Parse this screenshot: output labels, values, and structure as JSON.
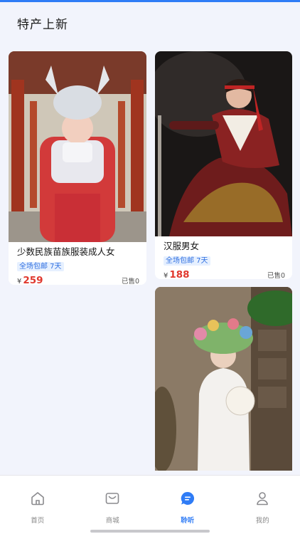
{
  "header": {
    "title": "特产上新"
  },
  "products": [
    {
      "name": "少数民族苗族服装成人女",
      "tag": "全场包邮 7天",
      "currency": "¥",
      "price": "259",
      "sold": "已售0"
    },
    {
      "name": "汉服男女",
      "tag": "全场包邮 7天",
      "currency": "¥",
      "price": "188",
      "sold": "已售0"
    }
  ],
  "tabbar": {
    "items": [
      {
        "label": "首页",
        "icon": "home-icon"
      },
      {
        "label": "商城",
        "icon": "mall-icon"
      },
      {
        "label": "聆听",
        "icon": "chat-icon",
        "active": true
      },
      {
        "label": "我的",
        "icon": "profile-icon"
      }
    ]
  },
  "colors": {
    "accent": "#2f7cf6",
    "price": "#e0382e",
    "tag_bg": "#e6f0ff",
    "background": "#f2f4fc"
  }
}
